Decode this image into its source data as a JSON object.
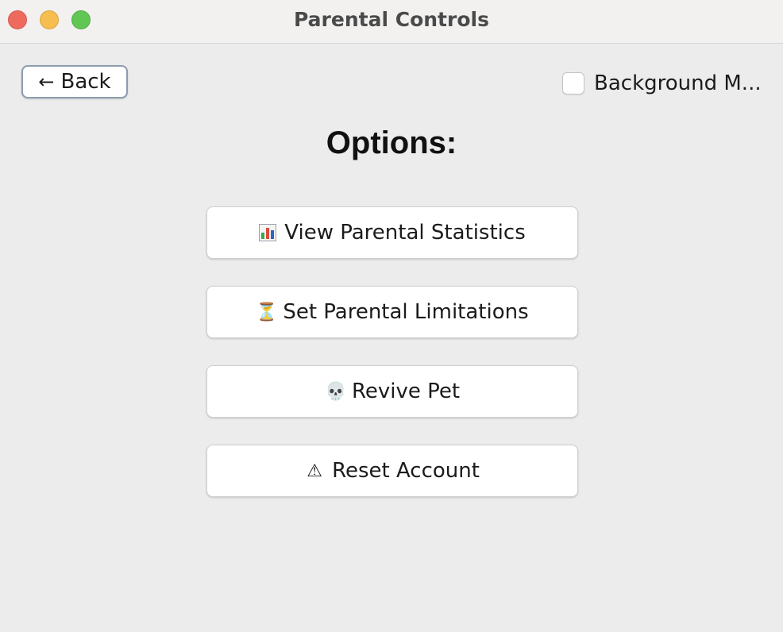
{
  "window": {
    "title": "Parental Controls"
  },
  "toolbar": {
    "back_arrow": "←",
    "back_label": "Back",
    "background_music_label": "Background M...",
    "background_music_checked": false
  },
  "main": {
    "heading": "Options:",
    "buttons": [
      {
        "icon": "bar-chart-icon",
        "glyph": "",
        "label": "View Parental Statistics"
      },
      {
        "icon": "hourglass-icon",
        "glyph": "⏳",
        "label": "Set Parental Limitations"
      },
      {
        "icon": "skull-icon",
        "glyph": "💀",
        "label": "Revive Pet"
      },
      {
        "icon": "warning-icon",
        "glyph": "⚠",
        "label": "Reset Account"
      }
    ]
  },
  "colors": {
    "background": "#ececec",
    "close": "#ee6a5f",
    "minimize": "#f5be4f",
    "zoom": "#62c655",
    "back_border": "#8d9bb1"
  }
}
